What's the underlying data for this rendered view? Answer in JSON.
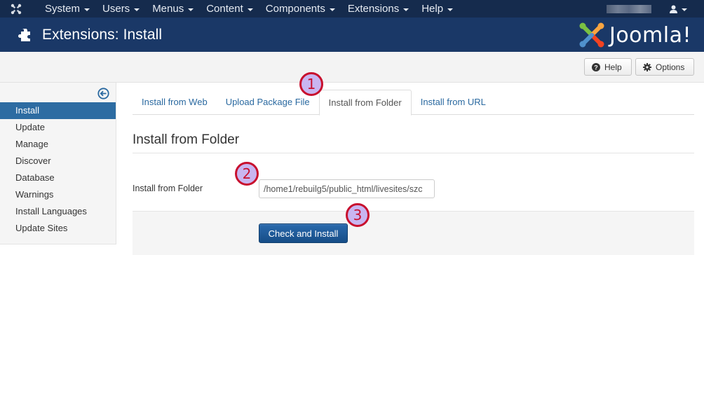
{
  "topnav": {
    "logo_icon": "joomla-x-icon",
    "menu": [
      {
        "label": "System"
      },
      {
        "label": "Users"
      },
      {
        "label": "Menus"
      },
      {
        "label": "Content"
      },
      {
        "label": "Components"
      },
      {
        "label": "Extensions"
      },
      {
        "label": "Help"
      }
    ],
    "user_icon": "user-icon"
  },
  "header": {
    "icon": "puzzle-icon",
    "title": "Extensions: Install",
    "brand": "Joomla!"
  },
  "toolbar": {
    "help_label": "Help",
    "options_label": "Options"
  },
  "sidebar": {
    "collapse_icon": "arrow-circle-left-icon",
    "items": [
      {
        "label": "Install",
        "active": true
      },
      {
        "label": "Update"
      },
      {
        "label": "Manage"
      },
      {
        "label": "Discover"
      },
      {
        "label": "Database"
      },
      {
        "label": "Warnings"
      },
      {
        "label": "Install Languages"
      },
      {
        "label": "Update Sites"
      }
    ]
  },
  "tabs": [
    {
      "label": "Install from Web"
    },
    {
      "label": "Upload Package File"
    },
    {
      "label": "Install from Folder",
      "active": true
    },
    {
      "label": "Install from URL"
    }
  ],
  "main": {
    "section_title": "Install from Folder",
    "field_label": "Install from Folder",
    "folder_value": "/home1/rebuilg5/public_html/livesites/szc",
    "install_button": "Check and Install"
  },
  "callouts": [
    "1",
    "2",
    "3"
  ],
  "colors": {
    "topnav_bg": "#152b4d",
    "header_bg": "#1a3867",
    "active_sidebar": "#2d6ca2",
    "link": "#2a69a0",
    "primary_button": "#1f5c9a",
    "callout_fill": "#c9b5f0",
    "callout_border": "#c8102e"
  }
}
